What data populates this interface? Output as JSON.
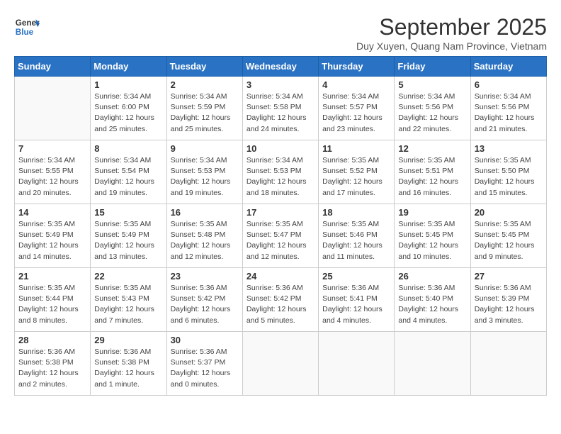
{
  "logo": {
    "line1": "General",
    "line2": "Blue"
  },
  "title": "September 2025",
  "subtitle": "Duy Xuyen, Quang Nam Province, Vietnam",
  "days_of_week": [
    "Sunday",
    "Monday",
    "Tuesday",
    "Wednesday",
    "Thursday",
    "Friday",
    "Saturday"
  ],
  "weeks": [
    [
      {
        "day": "",
        "info": ""
      },
      {
        "day": "1",
        "info": "Sunrise: 5:34 AM\nSunset: 6:00 PM\nDaylight: 12 hours\nand 25 minutes."
      },
      {
        "day": "2",
        "info": "Sunrise: 5:34 AM\nSunset: 5:59 PM\nDaylight: 12 hours\nand 25 minutes."
      },
      {
        "day": "3",
        "info": "Sunrise: 5:34 AM\nSunset: 5:58 PM\nDaylight: 12 hours\nand 24 minutes."
      },
      {
        "day": "4",
        "info": "Sunrise: 5:34 AM\nSunset: 5:57 PM\nDaylight: 12 hours\nand 23 minutes."
      },
      {
        "day": "5",
        "info": "Sunrise: 5:34 AM\nSunset: 5:56 PM\nDaylight: 12 hours\nand 22 minutes."
      },
      {
        "day": "6",
        "info": "Sunrise: 5:34 AM\nSunset: 5:56 PM\nDaylight: 12 hours\nand 21 minutes."
      }
    ],
    [
      {
        "day": "7",
        "info": "Sunrise: 5:34 AM\nSunset: 5:55 PM\nDaylight: 12 hours\nand 20 minutes."
      },
      {
        "day": "8",
        "info": "Sunrise: 5:34 AM\nSunset: 5:54 PM\nDaylight: 12 hours\nand 19 minutes."
      },
      {
        "day": "9",
        "info": "Sunrise: 5:34 AM\nSunset: 5:53 PM\nDaylight: 12 hours\nand 19 minutes."
      },
      {
        "day": "10",
        "info": "Sunrise: 5:34 AM\nSunset: 5:53 PM\nDaylight: 12 hours\nand 18 minutes."
      },
      {
        "day": "11",
        "info": "Sunrise: 5:35 AM\nSunset: 5:52 PM\nDaylight: 12 hours\nand 17 minutes."
      },
      {
        "day": "12",
        "info": "Sunrise: 5:35 AM\nSunset: 5:51 PM\nDaylight: 12 hours\nand 16 minutes."
      },
      {
        "day": "13",
        "info": "Sunrise: 5:35 AM\nSunset: 5:50 PM\nDaylight: 12 hours\nand 15 minutes."
      }
    ],
    [
      {
        "day": "14",
        "info": "Sunrise: 5:35 AM\nSunset: 5:49 PM\nDaylight: 12 hours\nand 14 minutes."
      },
      {
        "day": "15",
        "info": "Sunrise: 5:35 AM\nSunset: 5:49 PM\nDaylight: 12 hours\nand 13 minutes."
      },
      {
        "day": "16",
        "info": "Sunrise: 5:35 AM\nSunset: 5:48 PM\nDaylight: 12 hours\nand 12 minutes."
      },
      {
        "day": "17",
        "info": "Sunrise: 5:35 AM\nSunset: 5:47 PM\nDaylight: 12 hours\nand 12 minutes."
      },
      {
        "day": "18",
        "info": "Sunrise: 5:35 AM\nSunset: 5:46 PM\nDaylight: 12 hours\nand 11 minutes."
      },
      {
        "day": "19",
        "info": "Sunrise: 5:35 AM\nSunset: 5:45 PM\nDaylight: 12 hours\nand 10 minutes."
      },
      {
        "day": "20",
        "info": "Sunrise: 5:35 AM\nSunset: 5:45 PM\nDaylight: 12 hours\nand 9 minutes."
      }
    ],
    [
      {
        "day": "21",
        "info": "Sunrise: 5:35 AM\nSunset: 5:44 PM\nDaylight: 12 hours\nand 8 minutes."
      },
      {
        "day": "22",
        "info": "Sunrise: 5:35 AM\nSunset: 5:43 PM\nDaylight: 12 hours\nand 7 minutes."
      },
      {
        "day": "23",
        "info": "Sunrise: 5:36 AM\nSunset: 5:42 PM\nDaylight: 12 hours\nand 6 minutes."
      },
      {
        "day": "24",
        "info": "Sunrise: 5:36 AM\nSunset: 5:42 PM\nDaylight: 12 hours\nand 5 minutes."
      },
      {
        "day": "25",
        "info": "Sunrise: 5:36 AM\nSunset: 5:41 PM\nDaylight: 12 hours\nand 4 minutes."
      },
      {
        "day": "26",
        "info": "Sunrise: 5:36 AM\nSunset: 5:40 PM\nDaylight: 12 hours\nand 4 minutes."
      },
      {
        "day": "27",
        "info": "Sunrise: 5:36 AM\nSunset: 5:39 PM\nDaylight: 12 hours\nand 3 minutes."
      }
    ],
    [
      {
        "day": "28",
        "info": "Sunrise: 5:36 AM\nSunset: 5:38 PM\nDaylight: 12 hours\nand 2 minutes."
      },
      {
        "day": "29",
        "info": "Sunrise: 5:36 AM\nSunset: 5:38 PM\nDaylight: 12 hours\nand 1 minute."
      },
      {
        "day": "30",
        "info": "Sunrise: 5:36 AM\nSunset: 5:37 PM\nDaylight: 12 hours\nand 0 minutes."
      },
      {
        "day": "",
        "info": ""
      },
      {
        "day": "",
        "info": ""
      },
      {
        "day": "",
        "info": ""
      },
      {
        "day": "",
        "info": ""
      }
    ]
  ]
}
